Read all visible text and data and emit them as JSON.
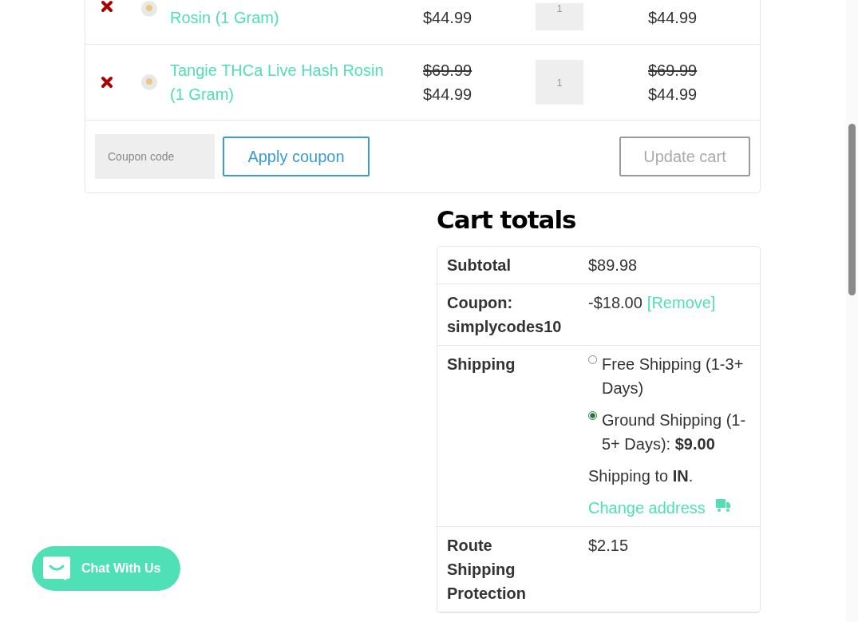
{
  "cart_items": [
    {
      "name": "Rosin (1 Gram)",
      "price": "$44.99",
      "quantity": "1",
      "subtotal": "$44.99"
    },
    {
      "name": "Tangie THCa Live Hash Rosin (1 Gram)",
      "old_price": "$69.99",
      "price": "$44.99",
      "quantity": "1",
      "old_subtotal": "$69.99",
      "subtotal": "$44.99"
    }
  ],
  "coupon": {
    "placeholder": "Coupon code",
    "apply_button": "Apply coupon"
  },
  "update_button": {
    "label": "Update cart",
    "disabled": true
  },
  "cart_totals": {
    "title": "Cart totals",
    "subtotal": {
      "label": "Subtotal",
      "value": "$89.98"
    },
    "coupon": {
      "label": "Coupon: simplycodes10",
      "value": "-$18.00",
      "remove_link": "[Remove]"
    },
    "shipping": {
      "label": "Shipping",
      "options": [
        {
          "label": "Free Shipping (1-3+ Days)",
          "selected": false
        },
        {
          "label": "Ground Shipping (1-5+ Days): **$9.00**",
          "selected": true
        }
      ],
      "destination": "Shipping to **IN**.",
      "change_link": "Change address"
    },
    "route": {
      "label": "Route Shipping Protection",
      "value": "$2.15"
    }
  },
  "chat_button": {
    "label": "Chat With Us"
  }
}
